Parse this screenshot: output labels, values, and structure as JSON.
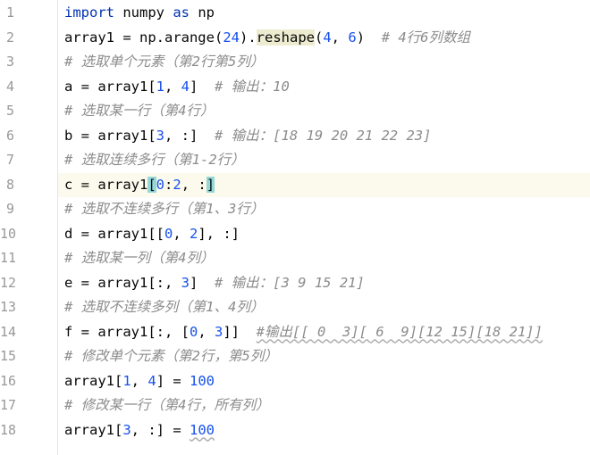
{
  "gutter": {
    "line_numbers": [
      "1",
      "2",
      "3",
      "4",
      "5",
      "6",
      "7",
      "8",
      "9",
      "10",
      "11",
      "12",
      "13",
      "14",
      "15",
      "16",
      "17",
      "18"
    ]
  },
  "editor": {
    "current_line": 8,
    "lines": [
      [
        {
          "t": "import",
          "c": "kw"
        },
        {
          "t": " numpy "
        },
        {
          "t": "as",
          "c": "kw"
        },
        {
          "t": " np"
        }
      ],
      [
        {
          "t": "array1 = np.arange("
        },
        {
          "t": "24",
          "c": "num"
        },
        {
          "t": ")."
        },
        {
          "t": "reshape",
          "c": "hl"
        },
        {
          "t": "("
        },
        {
          "t": "4",
          "c": "num"
        },
        {
          "t": ", "
        },
        {
          "t": "6",
          "c": "num"
        },
        {
          "t": ")  "
        },
        {
          "t": "# 4行6列数组",
          "c": "cm"
        }
      ],
      [
        {
          "t": "# 选取单个元素（第2行第5列）",
          "c": "cm"
        }
      ],
      [
        {
          "t": "a = array1["
        },
        {
          "t": "1",
          "c": "num"
        },
        {
          "t": ", "
        },
        {
          "t": "4",
          "c": "num"
        },
        {
          "t": "]  "
        },
        {
          "t": "# 输出：10",
          "c": "cm"
        }
      ],
      [
        {
          "t": "# 选取某一行（第4行）",
          "c": "cm"
        }
      ],
      [
        {
          "t": "b = array1["
        },
        {
          "t": "3",
          "c": "num"
        },
        {
          "t": ", :]  "
        },
        {
          "t": "# 输出：[18 19 20 21 22 23]",
          "c": "cm"
        }
      ],
      [
        {
          "t": "# 选取连续多行（第1-2行）",
          "c": "cm"
        }
      ],
      [
        {
          "t": "c = array1"
        },
        {
          "t": "[",
          "c": "bm"
        },
        {
          "t": "0",
          "c": "num"
        },
        {
          "t": ":"
        },
        {
          "t": "2",
          "c": "num"
        },
        {
          "t": ", :"
        },
        {
          "t": "]",
          "c": "bm"
        }
      ],
      [
        {
          "t": "# 选取不连续多行（第1、3行）",
          "c": "cm"
        }
      ],
      [
        {
          "t": "d = array1[["
        },
        {
          "t": "0",
          "c": "num"
        },
        {
          "t": ", "
        },
        {
          "t": "2",
          "c": "num"
        },
        {
          "t": "], :]"
        }
      ],
      [
        {
          "t": "# 选取某一列（第4列）",
          "c": "cm"
        }
      ],
      [
        {
          "t": "e = array1[:, "
        },
        {
          "t": "3",
          "c": "num"
        },
        {
          "t": "]  "
        },
        {
          "t": "# 输出：[3 9 15 21]",
          "c": "cm"
        }
      ],
      [
        {
          "t": "# 选取不连续多列（第1、4列）",
          "c": "cm"
        }
      ],
      [
        {
          "t": "f = array1[:, ["
        },
        {
          "t": "0",
          "c": "num"
        },
        {
          "t": ", "
        },
        {
          "t": "3",
          "c": "num"
        },
        {
          "t": "]]  "
        },
        {
          "t": "#输出[[ 0  3][ 6  9][12 15][18 21]]",
          "c": "cm wavy"
        }
      ],
      [
        {
          "t": "# 修改单个元素（第2行，第5列）",
          "c": "cm"
        }
      ],
      [
        {
          "t": "array1["
        },
        {
          "t": "1",
          "c": "num"
        },
        {
          "t": ", "
        },
        {
          "t": "4",
          "c": "num"
        },
        {
          "t": "] = "
        },
        {
          "t": "100",
          "c": "num"
        }
      ],
      [
        {
          "t": "# 修改某一行（第4行，所有列）",
          "c": "cm"
        }
      ],
      [
        {
          "t": "array1["
        },
        {
          "t": "3",
          "c": "num"
        },
        {
          "t": ", :] = "
        },
        {
          "t": "100",
          "c": "num wavy"
        }
      ]
    ]
  }
}
